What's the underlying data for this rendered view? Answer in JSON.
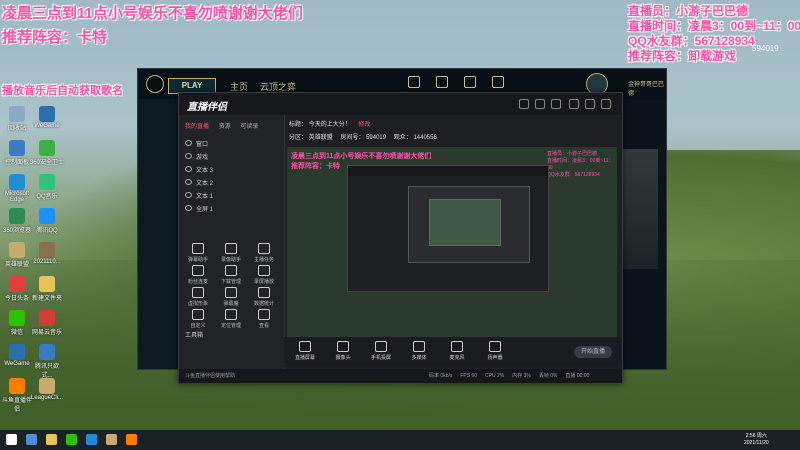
{
  "overlays": {
    "left_line1": "凌晨三点到11点小号娱乐不喜勿喷谢谢大佬们",
    "left_line2": "推荐阵容：卡特",
    "left_line3": "播放音乐后自动获取歌名",
    "right_line1": "直播员：小游子巴巴德",
    "right_line2": "直播时间：凌晨3：00到~11：00",
    "right_line3": "QQ水友群：567128934",
    "right_line4": "推荐阵容：卸载游戏",
    "room_id": "594019"
  },
  "desktop_icons": [
    {
      "label": "回收站",
      "color": "#8aa8c8"
    },
    {
      "label": "WeGame",
      "color": "#2a6fb0"
    },
    {
      "label": "控制面板",
      "color": "#3a7bc8"
    },
    {
      "label": "360安全卫士",
      "color": "#3cb043"
    },
    {
      "label": "Microsoft Edge",
      "color": "#1f8dd6"
    },
    {
      "label": "QQ音乐",
      "color": "#31c27c"
    },
    {
      "label": "360浏览器",
      "color": "#2e8b57"
    },
    {
      "label": "腾讯QQ",
      "color": "#1e90ff"
    },
    {
      "label": "英雄联盟",
      "color": "#c8aa6e"
    },
    {
      "label": "2021110...",
      "color": "#8a6f4e"
    },
    {
      "label": "今日头条",
      "color": "#e23e3e"
    },
    {
      "label": "新建文件夹",
      "color": "#e8c35a"
    },
    {
      "label": "微信",
      "color": "#2dc100"
    },
    {
      "label": "网易云音乐",
      "color": "#d43c33"
    },
    {
      "label": "WeGame",
      "color": "#2a6fb0"
    },
    {
      "label": "腾讯只欲式...",
      "color": "#3a7bc8"
    },
    {
      "label": "斗鱼直播伴侣",
      "color": "#ff7d00"
    },
    {
      "label": "LeagueCli...",
      "color": "#c8aa6e"
    }
  ],
  "lol_client": {
    "play": "PLAY",
    "nav_home": "主页",
    "nav_tft": "云顶之弈",
    "user": "金神哥哥巴巴德",
    "right_icons": [
      "生涯",
      "收藏",
      "战利品",
      "商城"
    ]
  },
  "streamer_app": {
    "app_name": "直播伴侣",
    "tabs": [
      "我的直播",
      "资源",
      "可读录"
    ],
    "sources": [
      "窗口",
      "游戏",
      "文本 3",
      "文本 2",
      "文本 1",
      "全屏 1"
    ],
    "tools_title": "工具箱",
    "tools": [
      "弹幕助手",
      "录像助手",
      "主播任务",
      "粉丝连麦",
      "下载管理",
      "录屏播放",
      "虚拟形象",
      "弹幕魔",
      "数据统计",
      "自定义",
      "定位管理",
      "查看"
    ],
    "room_title_label": "标题：",
    "room_title": "今天的上大分！",
    "edit_label": "修改",
    "category": "分区：",
    "category_value": "英雄联盟",
    "room_number_label": "房间号：",
    "room_number": "594019",
    "online_label": "观众：",
    "online_value": "1440556",
    "bottom_buttons": [
      "直播屏幕",
      "摄像头",
      "手机投屏",
      "多媒体",
      "麦克风",
      "扬声器"
    ],
    "start_live": "开始直播",
    "status_text": "斗鱼直播伴侣使用帮助",
    "status_right": [
      "码率 0kb/s",
      "FPS 60",
      "CPU 2%",
      "内存 3%",
      "丢帧 0%",
      "直播 00:00"
    ]
  },
  "taskbar": {
    "time": "2:56 周六",
    "date": "2021/11/20"
  }
}
